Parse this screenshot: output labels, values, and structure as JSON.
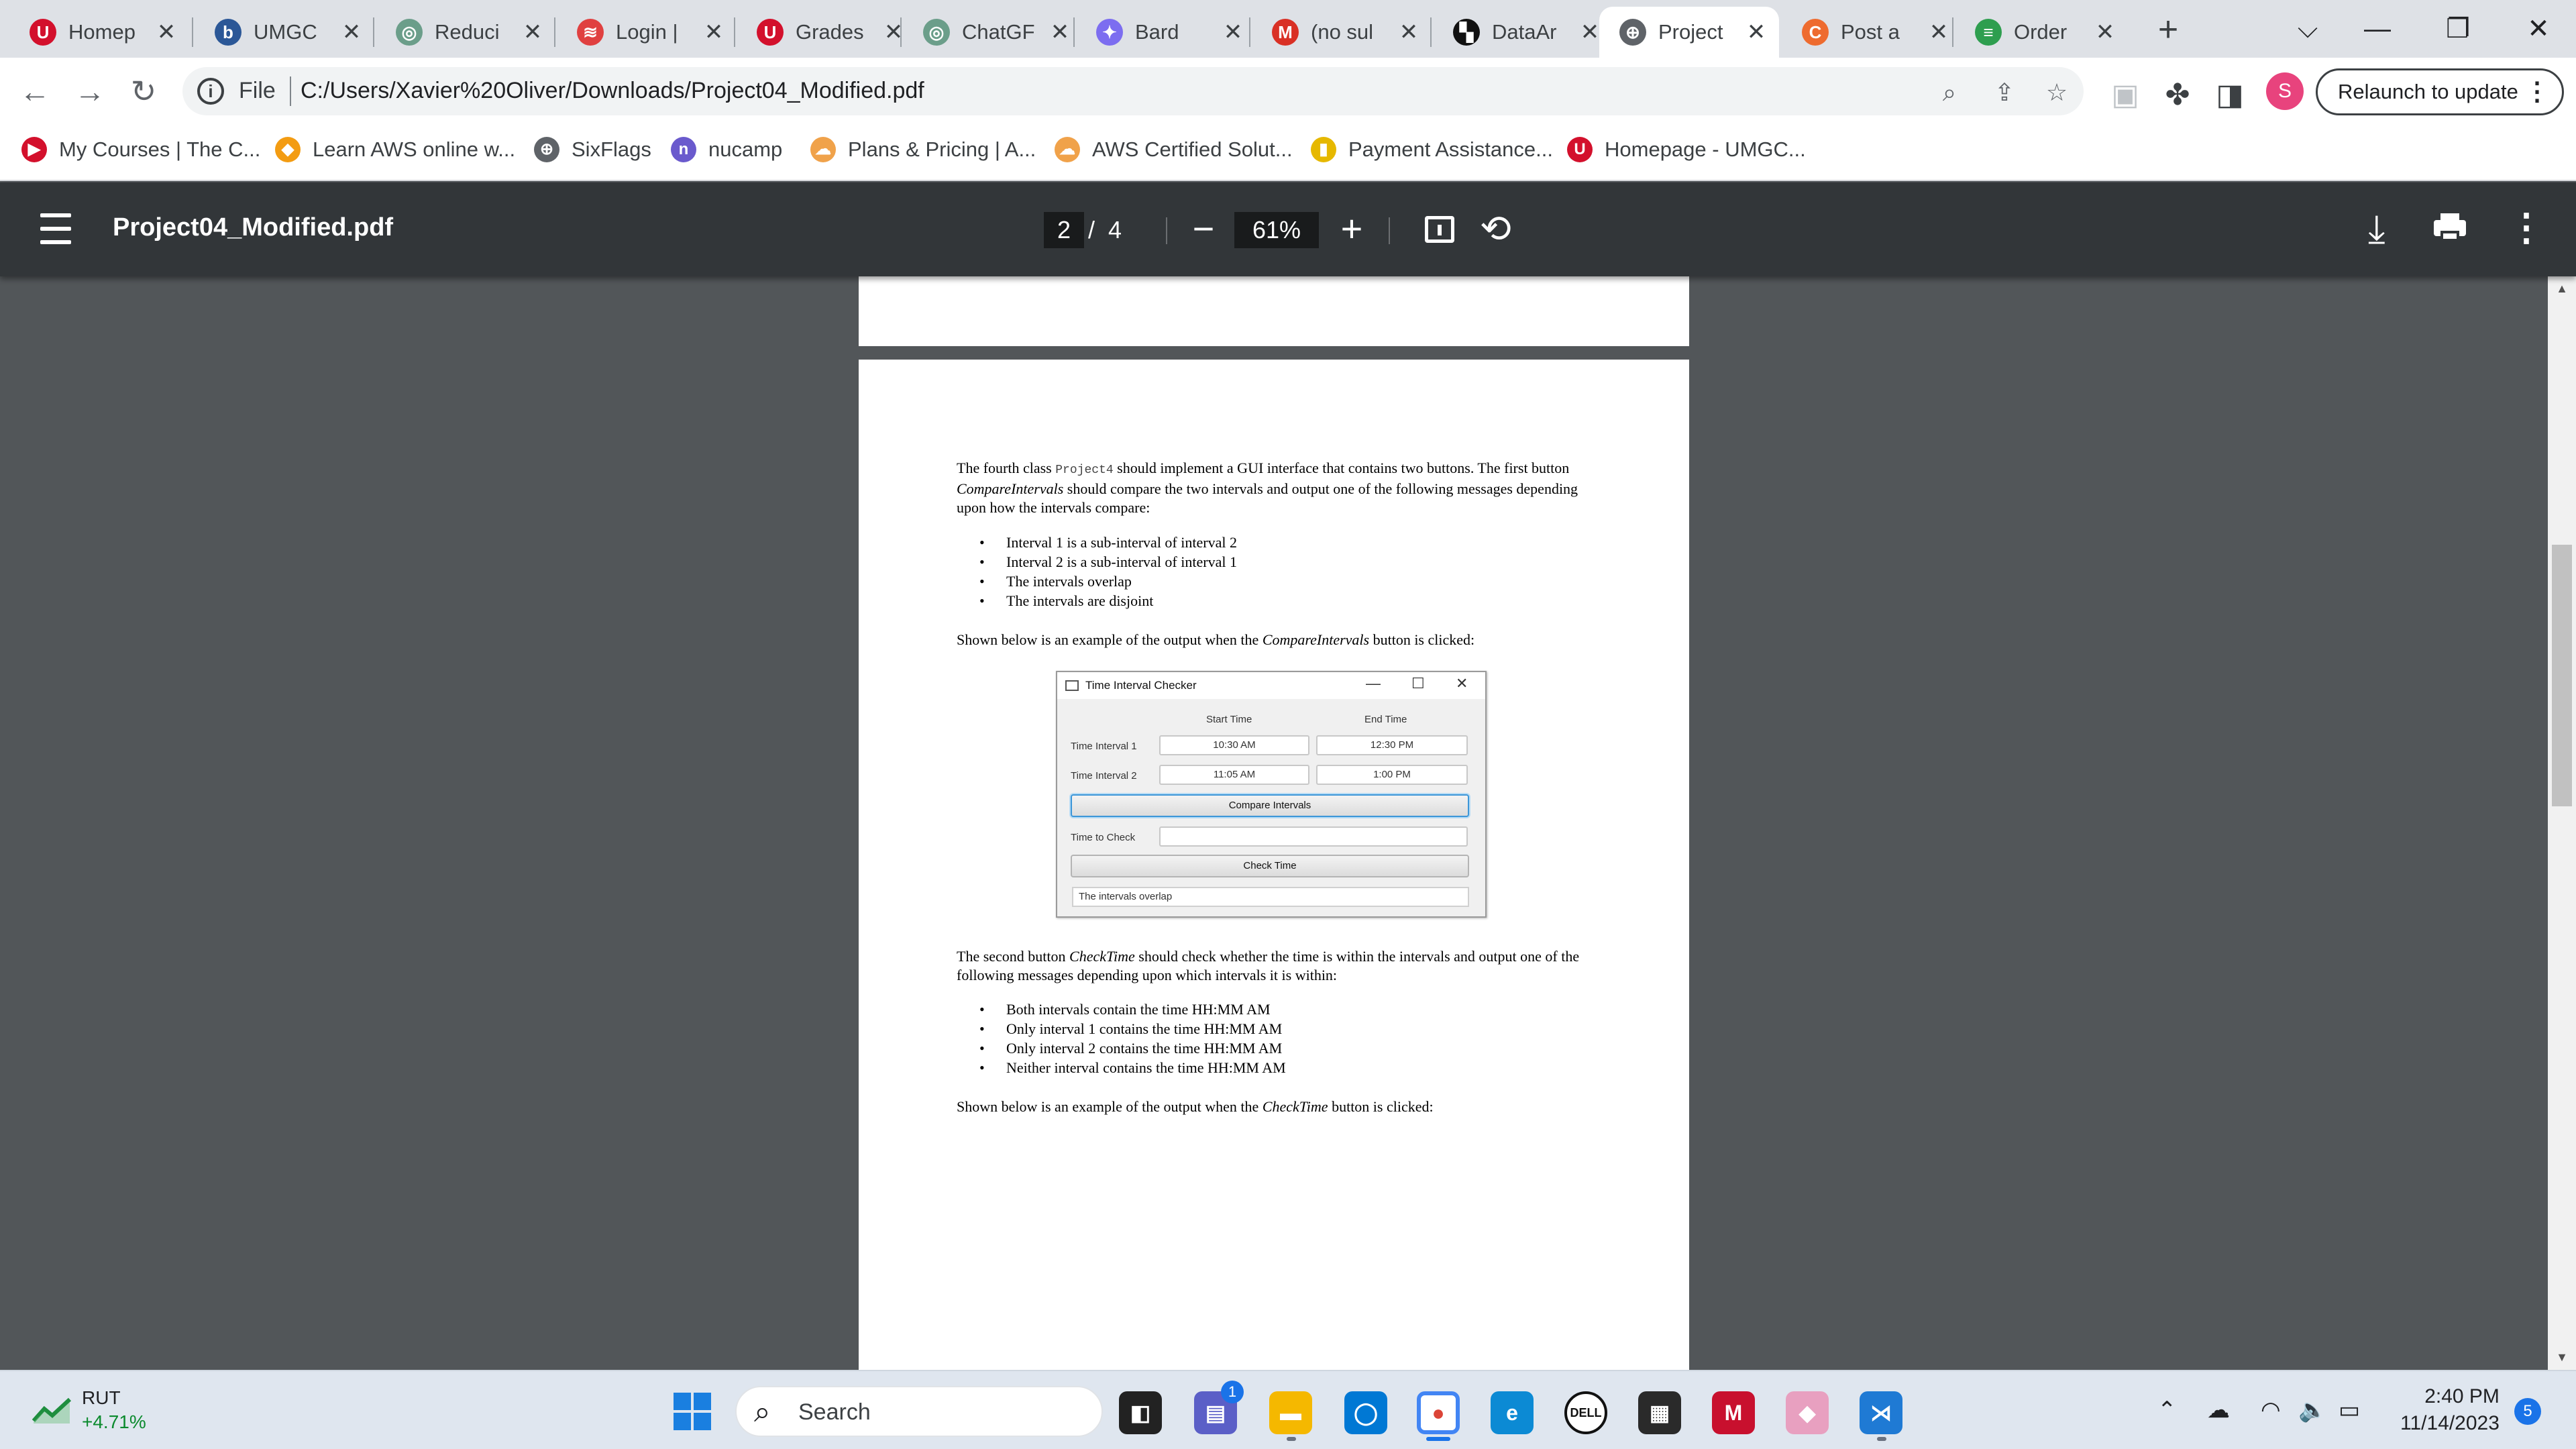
{
  "tabs": [
    {
      "title": "Homep",
      "icon": "umgc-icon",
      "color": "#d3102c",
      "glyph": "U",
      "active": false
    },
    {
      "title": "UMGC",
      "icon": "blackboard-icon",
      "color": "#2b5797",
      "glyph": "b",
      "active": false
    },
    {
      "title": "Reduci",
      "icon": "chatgpt-icon",
      "color": "#6b9e8a",
      "glyph": "◎",
      "active": false
    },
    {
      "title": "Login |",
      "icon": "login-icon",
      "color": "#e04040",
      "glyph": "≋",
      "active": false
    },
    {
      "title": "Grades",
      "icon": "umgc-icon",
      "color": "#d3102c",
      "glyph": "U",
      "active": false
    },
    {
      "title": "ChatGF",
      "icon": "chatgpt-icon",
      "color": "#6b9e8a",
      "glyph": "◎",
      "active": false
    },
    {
      "title": "Bard",
      "icon": "bard-icon",
      "color": "#7c6df0",
      "glyph": "✦",
      "active": false
    },
    {
      "title": "(no sul",
      "icon": "gmail-icon",
      "color": "#d93025",
      "glyph": "M",
      "active": false
    },
    {
      "title": "DataAr",
      "icon": "dataannotation-icon",
      "color": "#111111",
      "glyph": "▚",
      "active": false
    },
    {
      "title": "Project",
      "icon": "globe-icon",
      "color": "#5f6368",
      "glyph": "⊕",
      "active": true
    },
    {
      "title": "Post a",
      "icon": "chegg-icon",
      "color": "#ee6b2f",
      "glyph": "C",
      "active": false
    },
    {
      "title": "Order",
      "icon": "order-icon",
      "color": "#2e9e4f",
      "glyph": "≡",
      "active": false
    }
  ],
  "toolbar": {
    "scheme": "File",
    "url": "C:/Users/Xavier%20Oliver/Downloads/Project04_Modified.pdf",
    "profile_initial": "S",
    "relaunch_label": "Relaunch to update"
  },
  "bookmarks": [
    {
      "label": "My Courses | The C...",
      "icon": "mycourses-icon",
      "color": "#d3102c",
      "glyph": "▶"
    },
    {
      "label": "Learn AWS online w...",
      "icon": "aws-cube-icon",
      "color": "#f39c12",
      "glyph": "◆"
    },
    {
      "label": "SixFlags",
      "icon": "globe-icon",
      "color": "#5f6368",
      "glyph": "⊕"
    },
    {
      "label": "nucamp",
      "icon": "nucamp-icon",
      "color": "#6a5acd",
      "glyph": "n"
    },
    {
      "label": "Plans & Pricing | A...",
      "icon": "cloud-icon",
      "color": "#f0a24a",
      "glyph": "☁"
    },
    {
      "label": "AWS Certified Solut...",
      "icon": "cloud-icon",
      "color": "#f0a24a",
      "glyph": "☁"
    },
    {
      "label": "Payment Assistance...",
      "icon": "payment-icon",
      "color": "#e6b800",
      "glyph": "▮"
    },
    {
      "label": "Homepage - UMGC...",
      "icon": "umgc-icon",
      "color": "#d3102c",
      "glyph": "U"
    }
  ],
  "pdf": {
    "title": "Project04_Modified.pdf",
    "current_page": "2",
    "page_separator": "/",
    "total_pages": "4",
    "zoom": "61%"
  },
  "document": {
    "para1_a": "The fourth class ",
    "para1_code": "Project4",
    "para1_b": " should implement a GUI interface that contains two buttons. The first button ",
    "para1_em": "CompareIntervals",
    "para1_c": " should compare the two intervals and output one of the following messages depending upon how the intervals compare:",
    "compare_messages": [
      "Interval 1 is a sub-interval of interval 2",
      "Interval 2 is a sub-interval of interval 1",
      "The intervals overlap",
      "The intervals are disjoint"
    ],
    "shown1_a": "Shown below is an example of the output when the ",
    "shown1_em": "CompareIntervals",
    "shown1_b": " button is clicked:",
    "para2_a": "The second button ",
    "para2_em": "CheckTime",
    "para2_b": " should check whether the time is within the intervals and output one of the following messages depending upon which intervals it is within:",
    "check_messages": [
      "Both intervals contain the time HH:MM AM",
      "Only interval 1 contains the time HH:MM AM",
      "Only interval 2 contains the time HH:MM AM",
      "Neither interval contains the time HH:MM AM"
    ],
    "shown2_a": "Shown below is an example of the output when the ",
    "shown2_em": "CheckTime",
    "shown2_b": " button is clicked:"
  },
  "window_example": {
    "title": "Time Interval Checker",
    "col_start": "Start Time",
    "col_end": "End Time",
    "row1_label": "Time Interval 1",
    "row1_start": "10:30 AM",
    "row1_end": "12:30 PM",
    "row2_label": "Time Interval 2",
    "row2_start": "11:05 AM",
    "row2_end": "1:00 PM",
    "compare_button": "Compare Intervals",
    "time_check_label": "Time to Check",
    "time_check_value": "",
    "check_button": "Check Time",
    "output": "The intervals overlap"
  },
  "taskbar": {
    "stock_name": "RUT",
    "stock_change": "+4.71%",
    "search_placeholder": "Search",
    "teams_badge": "1",
    "time": "2:40 PM",
    "date": "11/14/2023",
    "notification_count": "5"
  }
}
